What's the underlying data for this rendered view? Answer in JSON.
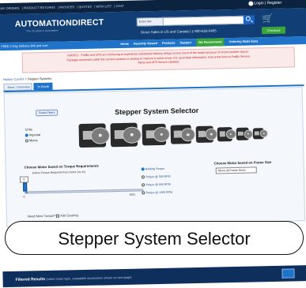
{
  "top_strip": {
    "links": [
      "MY ORDERS",
      "PRODUCT RETURNS",
      "INVOICES",
      "QUOTES",
      "WISH LIST",
      "CHAT"
    ],
    "login": "Login | Register"
  },
  "header": {
    "logo": "AUTOMATIONDIRECT",
    "tagline": "The #1 value in automation",
    "search_scope": "Entire Site",
    "direct_line": "Direct Sales in US and Canada | 1-800-633-0405",
    "checkout_label": "Checkout"
  },
  "navbar": {
    "promo": "FREE 2-Day Delivery $49 and over",
    "items": [
      "Home",
      "Recently Viewed",
      "Products",
      "Support"
    ],
    "highlight": "We Recommend",
    "last": "Ordering Made Easy"
  },
  "notice": {
    "lines": [
      "03/03/21 - FedEx and UPS are continuing to experience substantial delivery delays across much of the nation because of recent weather issues.",
      "Package movement within the carriers systems is starting to improve in some areas. For up-to-date information, look at the links to FedEx Service",
      "Alerts and UPS Service Updates"
    ]
  },
  "breadcrumb": {
    "parent": "Motion Control",
    "current": "Stepper Systems"
  },
  "tabs": {
    "overview": "Basic / Overview",
    "in_depth": "In Depth"
  },
  "selector": {
    "title": "Stepper System Selector",
    "reset_label": "Reset Filters",
    "units_label": "Units",
    "units_imperial": "Imperial",
    "units_metric": "Metric",
    "torque_heading": "Choose Motor based on Torque Requirements",
    "torque_sub": "Select Torque Required from motor (oz-in)",
    "torque_value": "0",
    "torque_min": "0",
    "torque_max": "1841",
    "torque_fill_fraction": 0.02,
    "holding_label": "Holding Torque",
    "opt_300": "Torque @ 300 RPM",
    "opt_600": "Torque @ 600 RPM",
    "opt_1000": "Torque @ 1000 RPM",
    "frame_heading": "Choose Motor based on Frame Size",
    "frame_select": "Show all Frame Sizes",
    "brake_line": "Need More Torque?",
    "brake_opt": "Add Gearing"
  },
  "results": {
    "title": "Filtered Results",
    "note": "(select motor type, compatible accessories shown on next page)"
  },
  "caption": "Stepper System Selector"
}
